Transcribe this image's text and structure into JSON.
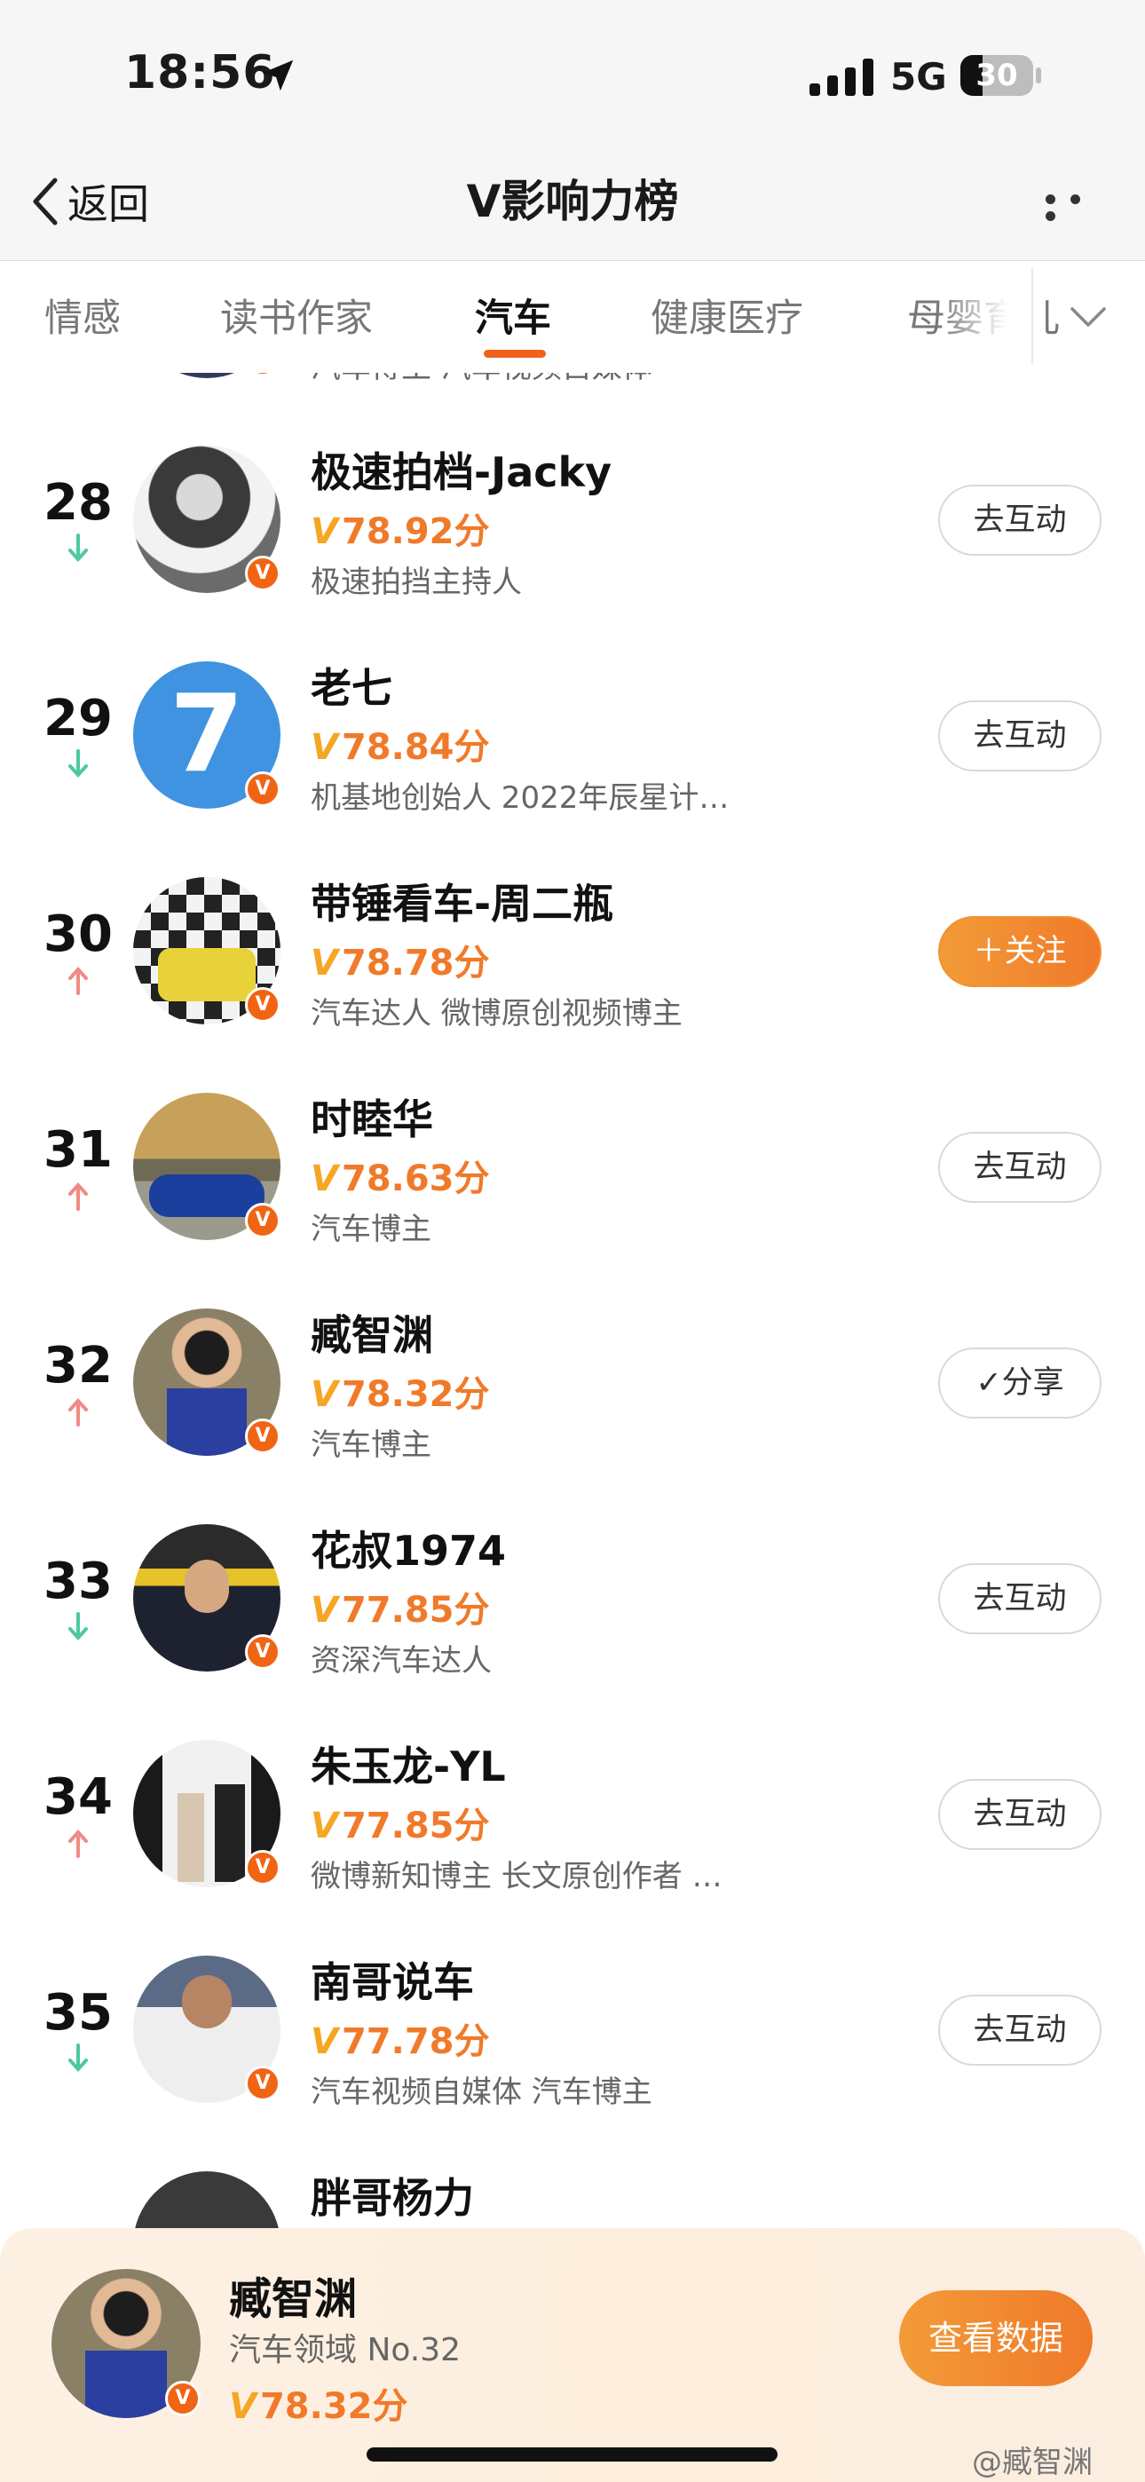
{
  "status_bar": {
    "time": "18:56",
    "network": "5G",
    "battery": "30",
    "battery_level_percent": 30
  },
  "nav": {
    "back_label": "返回",
    "title": "V影响力榜"
  },
  "tabs": [
    {
      "label": "情感",
      "active": false
    },
    {
      "label": "读书作家",
      "active": false
    },
    {
      "label": "汽车",
      "active": true
    },
    {
      "label": "健康医疗",
      "active": false
    },
    {
      "label": "母婴育儿",
      "active": false
    }
  ],
  "list": {
    "partial_top": {
      "desc": "汽车博主 汽车视频自媒体",
      "trend": "down"
    },
    "rows": [
      {
        "rank": "28",
        "trend": "down",
        "name": "极速拍档-Jacky",
        "score": "78.92分",
        "desc": "极速拍挡主持人",
        "action": "去互动",
        "action_type": "interact"
      },
      {
        "rank": "29",
        "trend": "down",
        "name": "老七",
        "score": "78.84分",
        "desc": "机基地创始人 2022年辰星计…",
        "action": "去互动",
        "action_type": "interact"
      },
      {
        "rank": "30",
        "trend": "up",
        "name": "带锤看车-周二瓶",
        "score": "78.78分",
        "desc": "汽车达人 微博原创视频博主",
        "action": "＋关注",
        "action_type": "follow"
      },
      {
        "rank": "31",
        "trend": "up",
        "name": "时睦华",
        "score": "78.63分",
        "desc": "汽车博主",
        "action": "去互动",
        "action_type": "interact"
      },
      {
        "rank": "32",
        "trend": "up",
        "name": "臧智渊",
        "score": "78.32分",
        "desc": "汽车博主",
        "action": "✓分享",
        "action_type": "share"
      },
      {
        "rank": "33",
        "trend": "down",
        "name": "花叔1974",
        "score": "77.85分",
        "desc": "资深汽车达人",
        "action": "去互动",
        "action_type": "interact"
      },
      {
        "rank": "34",
        "trend": "up",
        "name": "朱玉龙-YL",
        "score": "77.85分",
        "desc": "微博新知博主 长文原创作者 …",
        "action": "去互动",
        "action_type": "interact"
      },
      {
        "rank": "35",
        "trend": "down",
        "name": "南哥说车",
        "score": "77.78分",
        "desc": "汽车视频自媒体 汽车博主",
        "action": "去互动",
        "action_type": "interact"
      },
      {
        "rank": "",
        "trend": "",
        "name": "胖哥杨力",
        "score": "",
        "desc": "",
        "action": "",
        "action_type": "none"
      }
    ]
  },
  "my_card": {
    "name": "臧智渊",
    "domain": "汽车领域 No.32",
    "score": "78.32分",
    "button": "查看数据"
  },
  "badge_letter": "V",
  "score_prefix": "V",
  "avatar_7_label": "7",
  "watermark": "@臧智渊",
  "colors": {
    "accent": "#f07a2a",
    "trend_up": "#f08a84",
    "trend_down": "#4cc9a0"
  }
}
